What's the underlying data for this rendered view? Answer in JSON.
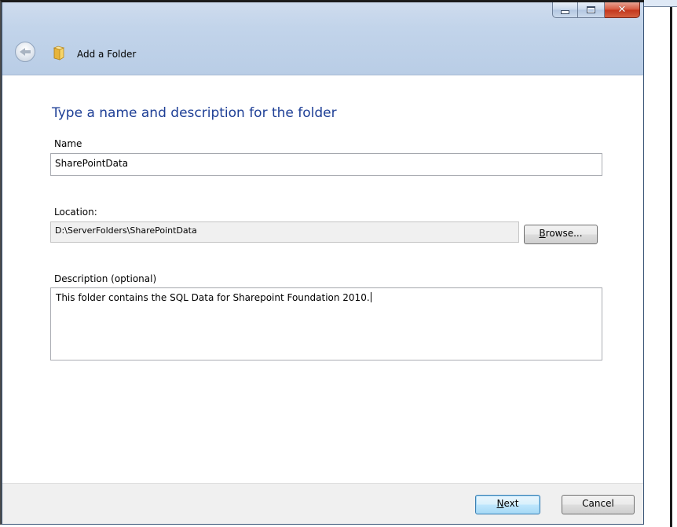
{
  "window": {
    "title": "Add a Folder",
    "caption": {
      "minimize": "minimize-icon",
      "maximize": "maximize-icon",
      "close": "close-icon"
    }
  },
  "form": {
    "heading": "Type a name and description for the folder",
    "name_label": "Name",
    "name_value": "SharePointData",
    "location_label": "Location:",
    "location_value": "D:\\ServerFolders\\SharePointData",
    "browse_label_accel": "B",
    "browse_label_rest": "rowse...",
    "description_label": "Description (optional)",
    "description_value": "This folder contains the SQL Data for Sharepoint Foundation 2010."
  },
  "footer": {
    "next_accel": "N",
    "next_rest": "ext",
    "cancel_label": "Cancel"
  },
  "colors": {
    "heading": "#1e3f96",
    "chrome": "#c2d4ea",
    "footer": "#f0f0f0",
    "close_button": "#c2351b"
  }
}
